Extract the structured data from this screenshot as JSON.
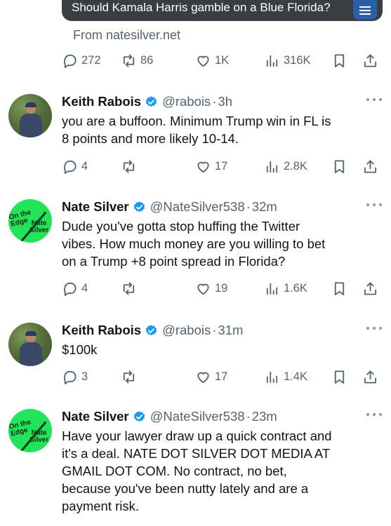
{
  "quoted": {
    "headline": "Should Kamala Harris gamble on a Blue Florida?",
    "source": "From natesilver.net",
    "stats": {
      "replies": "272",
      "reposts": "86",
      "likes": "1K",
      "views": "316K"
    }
  },
  "tweets": [
    {
      "name": "Keith Rabois",
      "handle": "@rabois",
      "time": "3h",
      "verified": true,
      "avatar": "keith-avatar-photo",
      "lines": [
        "you are a buffoon.  Minimum Trump win in FL is",
        "8 points and more likely 10-14."
      ],
      "stats": {
        "replies": "4",
        "reposts": "",
        "likes": "17",
        "views": "2.8K"
      }
    },
    {
      "name": "Nate Silver",
      "handle": "@NateSilver538",
      "time": "32m",
      "verified": true,
      "avatar": "nate-avatar-logo",
      "lines": [
        "Dude you've gotta stop huffing the Twitter",
        "vibes. How much money are you willing to bet",
        "on a Trump +8 point spread in Florida?"
      ],
      "stats": {
        "replies": "4",
        "reposts": "",
        "likes": "19",
        "views": "1.6K"
      }
    },
    {
      "name": "Keith Rabois",
      "handle": "@rabois",
      "time": "31m",
      "verified": true,
      "avatar": "keith-avatar-photo",
      "lines": [
        "$100k"
      ],
      "stats": {
        "replies": "3",
        "reposts": "",
        "likes": "17",
        "views": "1.4K"
      }
    },
    {
      "name": "Nate Silver",
      "handle": "@NateSilver538",
      "time": "23m",
      "verified": true,
      "avatar": "nate-avatar-logo",
      "lines": [
        "Have your lawyer draw up a quick contract and",
        "it's a deal. NATE DOT SILVER DOT MEDIA AT",
        "GMAIL DOT COM. No contract, no bet,",
        "because you've been nutty lately and are a",
        "payment risk."
      ],
      "stats": null
    }
  ],
  "nate_avatar_text": {
    "line1": "On the",
    "line2": "Edge",
    "line3": "Nate",
    "line4": "Silver"
  },
  "colors": {
    "verified": "#1d9bf0",
    "muted": "#536471",
    "nate_green": "#22e35a"
  }
}
